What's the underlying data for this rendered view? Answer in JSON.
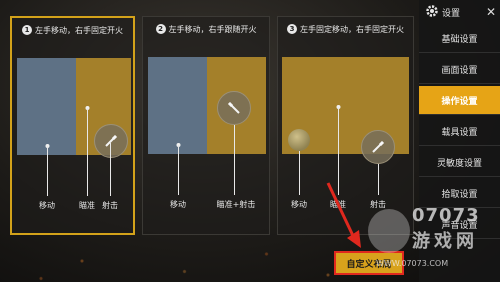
{
  "schemes": [
    {
      "num": "1",
      "title": "左手移动，右手固定开火",
      "labels": {
        "move": "移动",
        "aim": "瞄准",
        "fire": "射击"
      },
      "selected": true
    },
    {
      "num": "2",
      "title": "左手移动，右手跟随开火",
      "labels": {
        "move": "移动",
        "aim_fire": "瞄准+射击"
      },
      "selected": false
    },
    {
      "num": "3",
      "title": "左手固定移动，右手固定开火",
      "labels": {
        "move": "移动",
        "aim": "瞄准",
        "fire": "射击"
      },
      "selected": false
    }
  ],
  "panel": {
    "title": "设置",
    "close": "✕",
    "items": [
      "基础设置",
      "画面设置",
      "操作设置",
      "载具设置",
      "灵敏度设置",
      "拾取设置",
      "声音设置"
    ],
    "active_index": 2
  },
  "custom_button": "自定义布局",
  "watermark": {
    "number": "07073",
    "name": "游戏网",
    "url": "WWW.07073.COM"
  },
  "colors": {
    "accent": "#e6a416",
    "highlight_border": "#e0281e",
    "blue_zone": "#5e7185",
    "gold_zone": "#a4802a"
  }
}
